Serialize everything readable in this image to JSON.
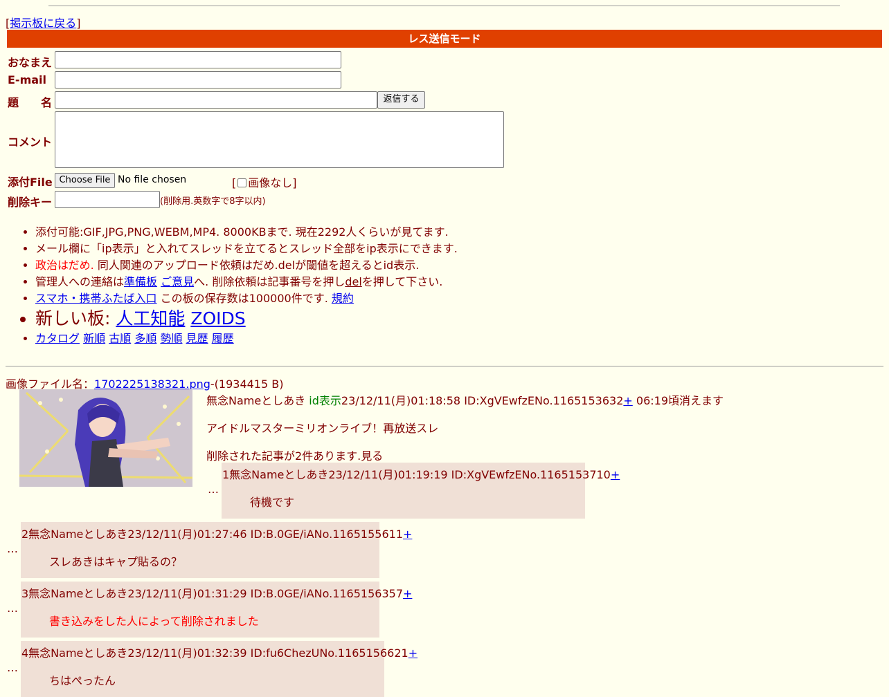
{
  "nav": {
    "back_open": "[",
    "back_link": "掲示板に戻る",
    "back_close": "]"
  },
  "form": {
    "mode_title": "レス送信モード",
    "name_label": "おなまえ",
    "email_label": "E-mail",
    "subject_label": "題　　名",
    "submit_label": "返信する",
    "comment_label": "コメント",
    "file_label": "添付File",
    "file_button": "Choose File",
    "file_status": "No file chosen",
    "noimage_open": "[",
    "noimage_label": "画像なし",
    "noimage_close": "]",
    "delkey_label": "削除キー",
    "delkey_note": "(削除用.英数字で8字以内)"
  },
  "rules": {
    "r1": "添付可能:GIF,JPG,PNG,WEBM,MP4. 8000KBまで. 現在2292人くらいが見てます.",
    "r2": "メール欄に「ip表示」と入れてスレッドを立てるとスレッド全部をip表示にできます.",
    "r3_red": "政治はだめ.",
    "r3_rest": " 同人関連のアップロード依頼はだめ.delが閾値を超えるとid表示.",
    "r4_a": "管理人への連絡は",
    "r4_link1": "準備板",
    "r4_link2": "ご意見",
    "r4_b": "へ. 削除依頼は記事番号を押し",
    "r4_link3": "del",
    "r4_c": "を押して下さい.",
    "r5_link": "スマホ・携帯ふたば入口",
    "r5_text": " この板の保存数は100000件です. ",
    "r5_link2": "規約",
    "r6_text": "新しい板: ",
    "r6_link1": "人工知能",
    "r6_link2": "ZOIDS",
    "sort_links": [
      "カタログ",
      "新順",
      "古順",
      "多順",
      "勢順",
      "見歴",
      "履歴"
    ]
  },
  "thread": {
    "file_label": "画像ファイル名：",
    "file_name": "1702225138321.png",
    "file_size": "-(1934415 B)",
    "op_name": "無念Nameとしあき ",
    "op_id_tag": "id表示",
    "op_meta": "23/12/11(月)01:18:58 ID:XgVEwfzENo.1165153632",
    "op_plus": "+",
    "op_expire": " 06:19頃消えます",
    "op_body": "アイドルマスターミリオンライブ！再放送スレ",
    "deleted_note": "削除された記事が2件あります.見る",
    "ellipsis": "…",
    "replies": [
      {
        "header": "1無念Nameとしあき23/12/11(月)01:19:19 ID:XgVEwfzENo.1165153710",
        "plus": "+",
        "body": "待機です",
        "deleted": false
      },
      {
        "header": "2無念Nameとしあき23/12/11(月)01:27:46 ID:B.0GE/iANo.1165155611",
        "plus": "+",
        "body": "スレあきはキャプ貼るの？",
        "deleted": false
      },
      {
        "header": "3無念Nameとしあき23/12/11(月)01:31:29 ID:B.0GE/iANo.1165156357",
        "plus": "+",
        "body": "書き込みをした人によって削除されました",
        "deleted": true
      },
      {
        "header": "4無念Nameとしあき23/12/11(月)01:32:39 ID:fu6ChezUNo.1165156621",
        "plus": "+",
        "body": "ちはぺったん",
        "deleted": false
      }
    ]
  }
}
